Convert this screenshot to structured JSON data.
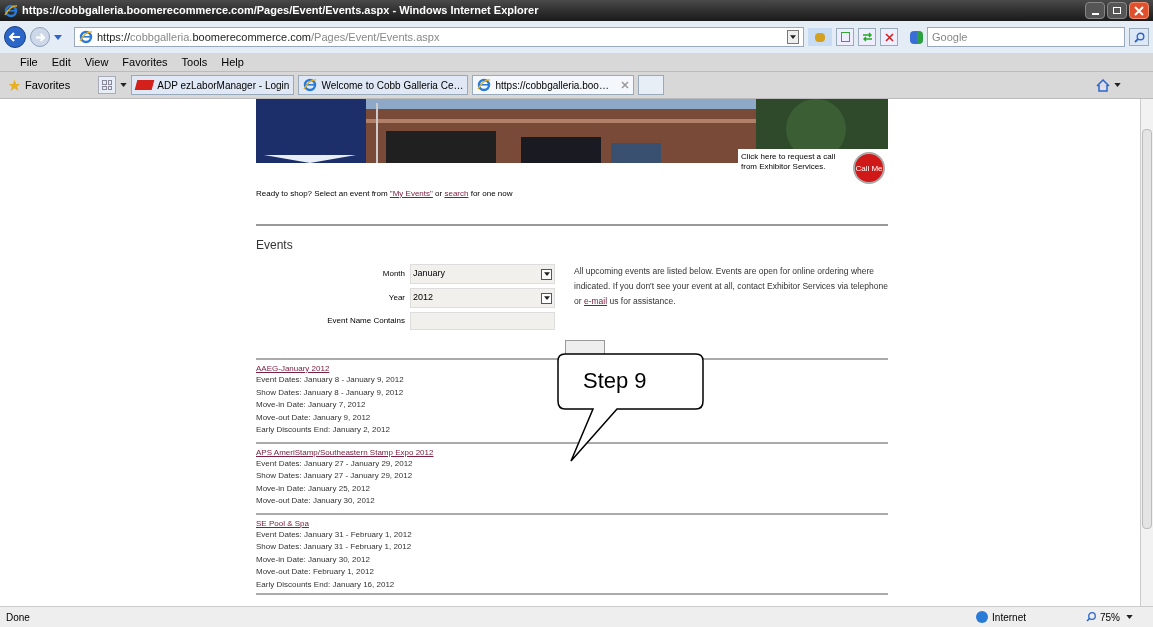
{
  "window": {
    "title": "https://cobbgalleria.boomerecommerce.com/Pages/Event/Events.aspx - Windows Internet Explorer"
  },
  "address_bar": {
    "scheme": "https://",
    "host_pre": "cobbgalleria.",
    "host_main": "boomerecommerce.com",
    "path": "/Pages/Event/Events.aspx"
  },
  "search_box": {
    "placeholder": "Google"
  },
  "menu": [
    "File",
    "Edit",
    "View",
    "Favorites",
    "Tools",
    "Help"
  ],
  "favorites_bar": {
    "label": "Favorites",
    "tabs": [
      {
        "label": "ADP ezLaborManager - Login",
        "kind": "adp",
        "selected": false
      },
      {
        "label": "Welcome to Cobb Galleria Ce…",
        "kind": "ie",
        "selected": false
      },
      {
        "label": "https://cobbgalleria.boo…",
        "kind": "ie",
        "selected": true
      }
    ]
  },
  "page": {
    "intro": {
      "before": "Ready to shop? Select an event from ",
      "link1": "\"My Events\"",
      "middle": " or ",
      "link2": "search",
      "after": " for one now"
    },
    "call_me": {
      "text": "Click here to request a call from Exhibitor Services.",
      "button": "Call Me"
    },
    "heading": "Events",
    "form": [
      {
        "label": "Month",
        "kind": "select",
        "value": "January"
      },
      {
        "label": "Year",
        "kind": "select",
        "value": "2012"
      },
      {
        "label": "Event Name Contains",
        "kind": "text"
      }
    ],
    "info": {
      "before": "All upcoming events are listed below. Events are open for online ordering where indicated. If you don't see your event at all, contact Exhibitor Services via telephone or ",
      "link": "e-mail",
      "after": " us for assistance."
    },
    "events": [
      {
        "title": "AAEG-January 2012",
        "lines": [
          "Event Dates: January 8 - January 9, 2012",
          "Show Dates: January 8 - January 9, 2012",
          "Move-in Date: January 7, 2012",
          "Move-out Date: January 9, 2012",
          "Early Discounts End: January 2, 2012"
        ]
      },
      {
        "title": "APS AmeriStamp/Southeastern Stamp Expo 2012",
        "lines": [
          "Event Dates: January 27 - January 29, 2012",
          "Show Dates: January 27 - January 29, 2012",
          "Move-in Date: January 25, 2012",
          "Move-out Date: January 30, 2012"
        ]
      },
      {
        "title": "SE Pool & Spa",
        "lines": [
          "Event Dates: January 31 - February 1, 2012",
          "Show Dates: January 31 - February 1, 2012",
          "Move-in Date: January 30, 2012",
          "Move-out Date: February 1, 2012",
          "Early Discounts End: January 16, 2012"
        ]
      }
    ]
  },
  "callout": {
    "text": "Step 9"
  },
  "status_bar": {
    "status": "Done",
    "zone": "Internet",
    "zoom": "75%"
  }
}
